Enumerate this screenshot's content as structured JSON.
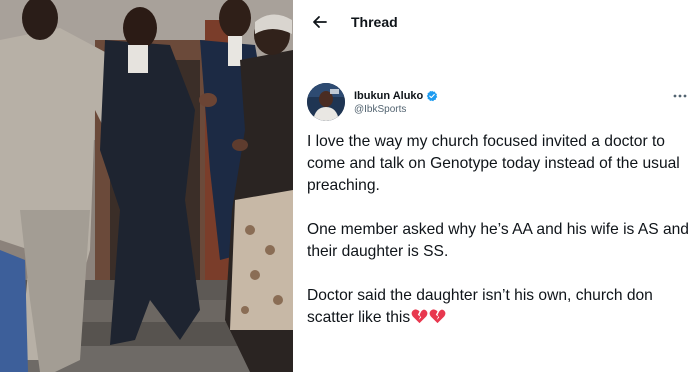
{
  "header": {
    "back_icon": "arrow-left-icon",
    "title": "Thread"
  },
  "tweet": {
    "author": {
      "display_name": "Ibukun Aluko",
      "handle": "@IbkSports",
      "verified": true,
      "verified_icon": "verified-badge-icon"
    },
    "more_icon": "more-options-icon",
    "paragraphs": [
      "I love the way my church focused invited a doctor to come and talk on Genotype today instead of the usual preaching.",
      "One member asked why he’s AA and his wife is AS and their daughter is SS.",
      "Doctor said the daughter isn’t his own, church don scatter like this"
    ],
    "emoji": [
      "broken-heart-icon",
      "broken-heart-icon"
    ]
  },
  "colors": {
    "text": "#0f1419",
    "secondary": "#536471",
    "verified_blue": "#1d9bf0",
    "broken_heart": "#e8384f"
  }
}
